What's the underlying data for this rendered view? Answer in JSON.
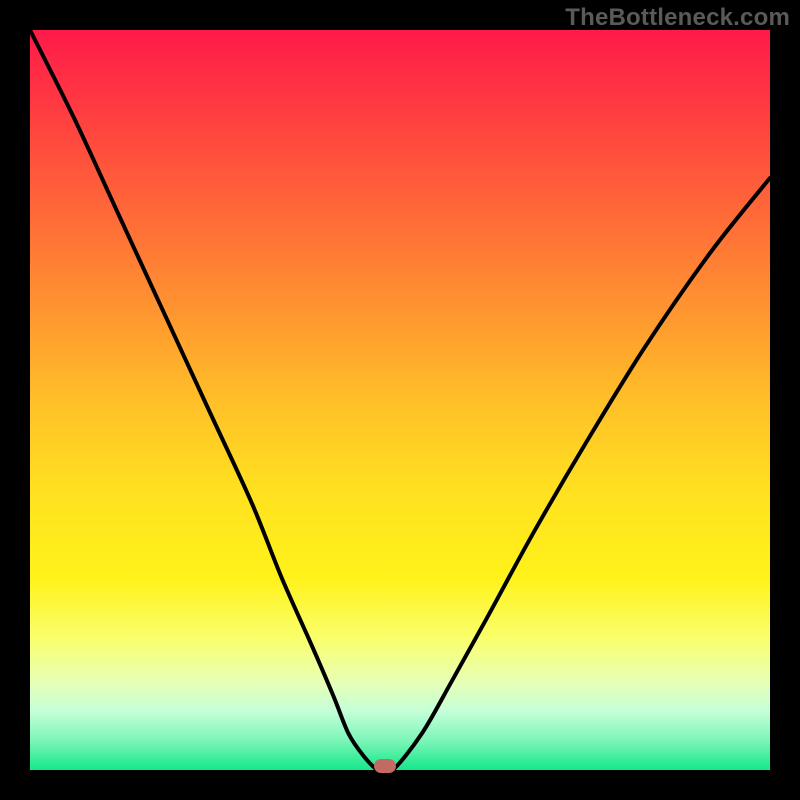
{
  "watermark": "TheBottleneck.com",
  "colors": {
    "page_bg": "#000000",
    "gradient_top": "#ff1a49",
    "gradient_bottom": "#15e88a",
    "curve": "#000000",
    "marker": "#c36a63"
  },
  "chart_data": {
    "type": "line",
    "title": "",
    "xlabel": "",
    "ylabel": "",
    "xlim": [
      0,
      100
    ],
    "ylim": [
      0,
      100
    ],
    "grid": false,
    "legend": false,
    "series": [
      {
        "name": "bottleneck-curve",
        "x": [
          0,
          6,
          12,
          18,
          24,
          30,
          34,
          38,
          41,
          43,
          45,
          47,
          49,
          53,
          57,
          62,
          68,
          75,
          83,
          92,
          100
        ],
        "y": [
          100,
          88,
          75,
          62,
          49,
          36,
          26,
          17,
          10,
          5,
          2,
          0,
          0,
          5,
          12,
          21,
          32,
          44,
          57,
          70,
          80
        ]
      }
    ],
    "marker": {
      "x": 48,
      "y": 0
    },
    "background_gradient": {
      "type": "vertical",
      "stops": [
        {
          "pos": 0.0,
          "color": "#ff1a49"
        },
        {
          "pos": 0.25,
          "color": "#ff6a38"
        },
        {
          "pos": 0.5,
          "color": "#ffbf28"
        },
        {
          "pos": 0.74,
          "color": "#fff21a"
        },
        {
          "pos": 0.92,
          "color": "#c5ffd8"
        },
        {
          "pos": 1.0,
          "color": "#15e88a"
        }
      ]
    }
  }
}
